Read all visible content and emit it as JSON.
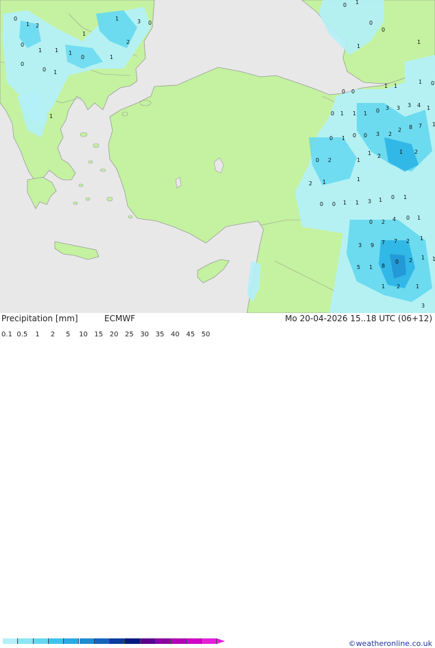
{
  "map": {
    "sea_color": "#e8e8e8",
    "land_color": "#c4f2a0",
    "border_color": "#9a9a9a",
    "precip_colors": [
      "#b4f0f8",
      "#64d8f0",
      "#2cb4e6",
      "#1e8cd2"
    ],
    "value_labels": [
      "0",
      "1",
      "2",
      "1",
      "3",
      "0",
      "1",
      "2",
      "0",
      "1",
      "1",
      "1",
      "0",
      "1",
      "0",
      "0",
      "1",
      "1",
      "0",
      "1",
      "0",
      "0",
      "1",
      "1",
      "0",
      "0",
      "1",
      "1",
      "1",
      "0",
      "0",
      "1",
      "1",
      "1",
      "0",
      "3",
      "3",
      "3",
      "4",
      "1",
      "2",
      "8",
      "7",
      "1",
      "0",
      "1",
      "0",
      "0",
      "3",
      "2",
      "1",
      "2",
      "0",
      "2",
      "1",
      "1",
      "2",
      "1",
      "2",
      "1",
      "0",
      "0",
      "1",
      "1",
      "3",
      "1",
      "0",
      "1",
      "0",
      "2",
      "4",
      "0",
      "1",
      "3",
      "9",
      "7",
      "7",
      "2",
      "1",
      "1",
      "5",
      "1",
      "8",
      "0",
      "2",
      "1",
      "1",
      "2",
      "1",
      "3"
    ]
  },
  "footer": {
    "title": "Precipitation [mm]",
    "model": "ECMWF",
    "datetime": "Mo 20-04-2026 15..18 UTC (06+12)",
    "copyright": "©weatheronline.co.uk"
  },
  "legend": {
    "labels": [
      "0.1",
      "0.5",
      "1",
      "2",
      "5",
      "10",
      "15",
      "20",
      "25",
      "30",
      "35",
      "40",
      "45",
      "50"
    ],
    "colors": [
      "#b4f0f8",
      "#8ce6f4",
      "#64d8f0",
      "#3cc4ec",
      "#2ca8e2",
      "#1e8cd2",
      "#1464be",
      "#0a3ca0",
      "#001a82",
      "#5a008c",
      "#8c00a0",
      "#b400b4",
      "#d200c8",
      "#e61edc"
    ]
  }
}
